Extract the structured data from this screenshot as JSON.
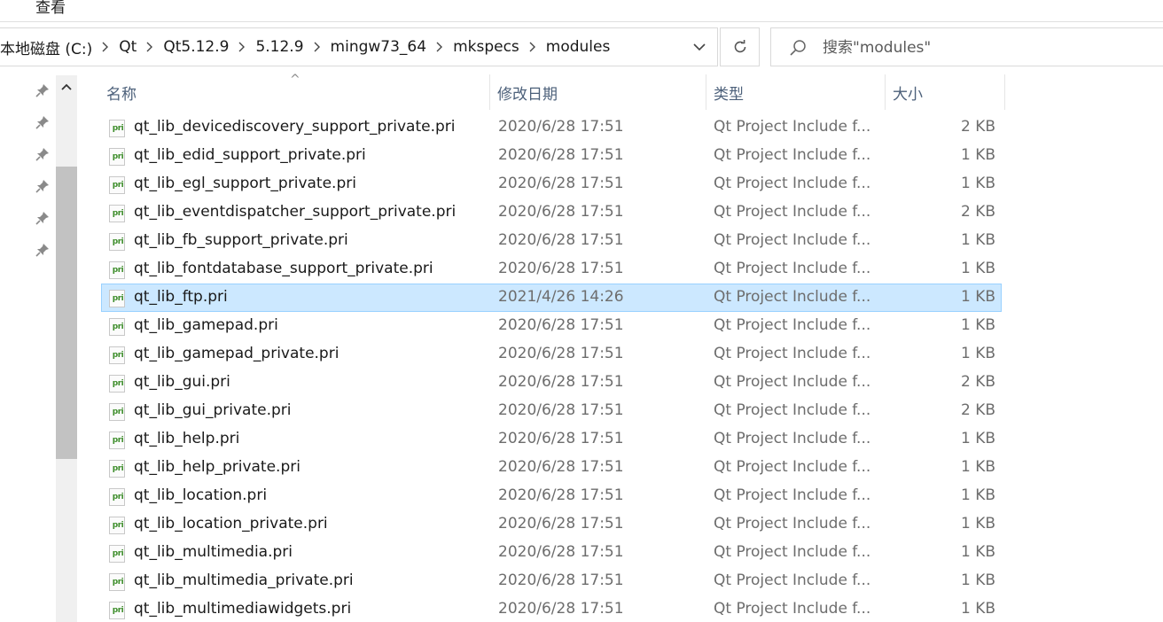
{
  "ribbon": {
    "view_tab": "查看"
  },
  "address": {
    "crumbs": [
      "本地磁盘 (C:)",
      "Qt",
      "Qt5.12.9",
      "5.12.9",
      "mingw73_64",
      "mkspecs",
      "modules"
    ]
  },
  "search": {
    "placeholder": "搜索\"modules\""
  },
  "columns": {
    "name": "名称",
    "date": "修改日期",
    "type": "类型",
    "size": "大小"
  },
  "file_icon_label": "pri",
  "files": [
    {
      "name": "qt_lib_devicediscovery_support_private.pri",
      "date": "2020/6/28 17:51",
      "type": "Qt Project Include f...",
      "size": "2 KB"
    },
    {
      "name": "qt_lib_edid_support_private.pri",
      "date": "2020/6/28 17:51",
      "type": "Qt Project Include f...",
      "size": "1 KB"
    },
    {
      "name": "qt_lib_egl_support_private.pri",
      "date": "2020/6/28 17:51",
      "type": "Qt Project Include f...",
      "size": "1 KB"
    },
    {
      "name": "qt_lib_eventdispatcher_support_private.pri",
      "date": "2020/6/28 17:51",
      "type": "Qt Project Include f...",
      "size": "2 KB"
    },
    {
      "name": "qt_lib_fb_support_private.pri",
      "date": "2020/6/28 17:51",
      "type": "Qt Project Include f...",
      "size": "1 KB"
    },
    {
      "name": "qt_lib_fontdatabase_support_private.pri",
      "date": "2020/6/28 17:51",
      "type": "Qt Project Include f...",
      "size": "1 KB"
    },
    {
      "name": "qt_lib_ftp.pri",
      "date": "2021/4/26 14:26",
      "type": "Qt Project Include f...",
      "size": "1 KB",
      "selected": true
    },
    {
      "name": "qt_lib_gamepad.pri",
      "date": "2020/6/28 17:51",
      "type": "Qt Project Include f...",
      "size": "1 KB"
    },
    {
      "name": "qt_lib_gamepad_private.pri",
      "date": "2020/6/28 17:51",
      "type": "Qt Project Include f...",
      "size": "1 KB"
    },
    {
      "name": "qt_lib_gui.pri",
      "date": "2020/6/28 17:51",
      "type": "Qt Project Include f...",
      "size": "2 KB"
    },
    {
      "name": "qt_lib_gui_private.pri",
      "date": "2020/6/28 17:51",
      "type": "Qt Project Include f...",
      "size": "2 KB"
    },
    {
      "name": "qt_lib_help.pri",
      "date": "2020/6/28 17:51",
      "type": "Qt Project Include f...",
      "size": "1 KB"
    },
    {
      "name": "qt_lib_help_private.pri",
      "date": "2020/6/28 17:51",
      "type": "Qt Project Include f...",
      "size": "1 KB"
    },
    {
      "name": "qt_lib_location.pri",
      "date": "2020/6/28 17:51",
      "type": "Qt Project Include f...",
      "size": "1 KB"
    },
    {
      "name": "qt_lib_location_private.pri",
      "date": "2020/6/28 17:51",
      "type": "Qt Project Include f...",
      "size": "1 KB"
    },
    {
      "name": "qt_lib_multimedia.pri",
      "date": "2020/6/28 17:51",
      "type": "Qt Project Include f...",
      "size": "1 KB"
    },
    {
      "name": "qt_lib_multimedia_private.pri",
      "date": "2020/6/28 17:51",
      "type": "Qt Project Include f...",
      "size": "1 KB"
    },
    {
      "name": "qt_lib_multimediawidgets.pri",
      "date": "2020/6/28 17:51",
      "type": "Qt Project Include f...",
      "size": "1 KB"
    }
  ],
  "colors": {
    "selection_bg": "#cce8ff",
    "selection_border": "#99d1ff",
    "header_text": "#4c607a",
    "icon_green": "#3e8e2c"
  }
}
